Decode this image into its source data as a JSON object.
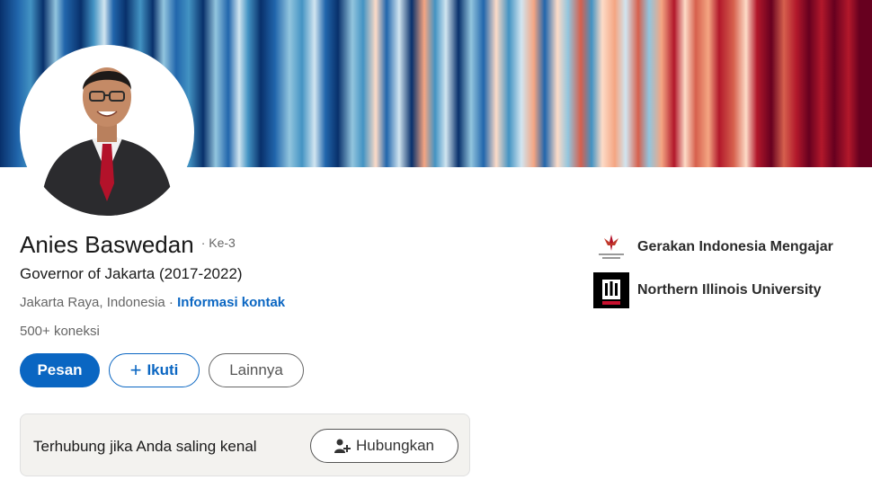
{
  "profile": {
    "name": "Anies Baswedan",
    "degree": "· Ke-3",
    "headline": "Governor of Jakarta (2017-2022)",
    "location": "Jakarta Raya, Indonesia",
    "separator": " · ",
    "contact_info_label": "Informasi kontak",
    "connections": "500+ koneksi"
  },
  "actions": {
    "message_label": "Pesan",
    "follow_label": "Ikuti",
    "more_label": "Lainnya"
  },
  "connect_card": {
    "text": "Terhubung jika Anda saling kenal",
    "button_label": "Hubungkan"
  },
  "organizations": [
    {
      "name": "Gerakan Indonesia Mengajar",
      "logo_icon": "indonesia-mengajar-logo"
    },
    {
      "name": "Northern Illinois University",
      "logo_icon": "niu-logo"
    }
  ],
  "colors": {
    "accent": "#0a66c2",
    "banner_blue": "#08306b",
    "banner_red": "#67001f"
  }
}
